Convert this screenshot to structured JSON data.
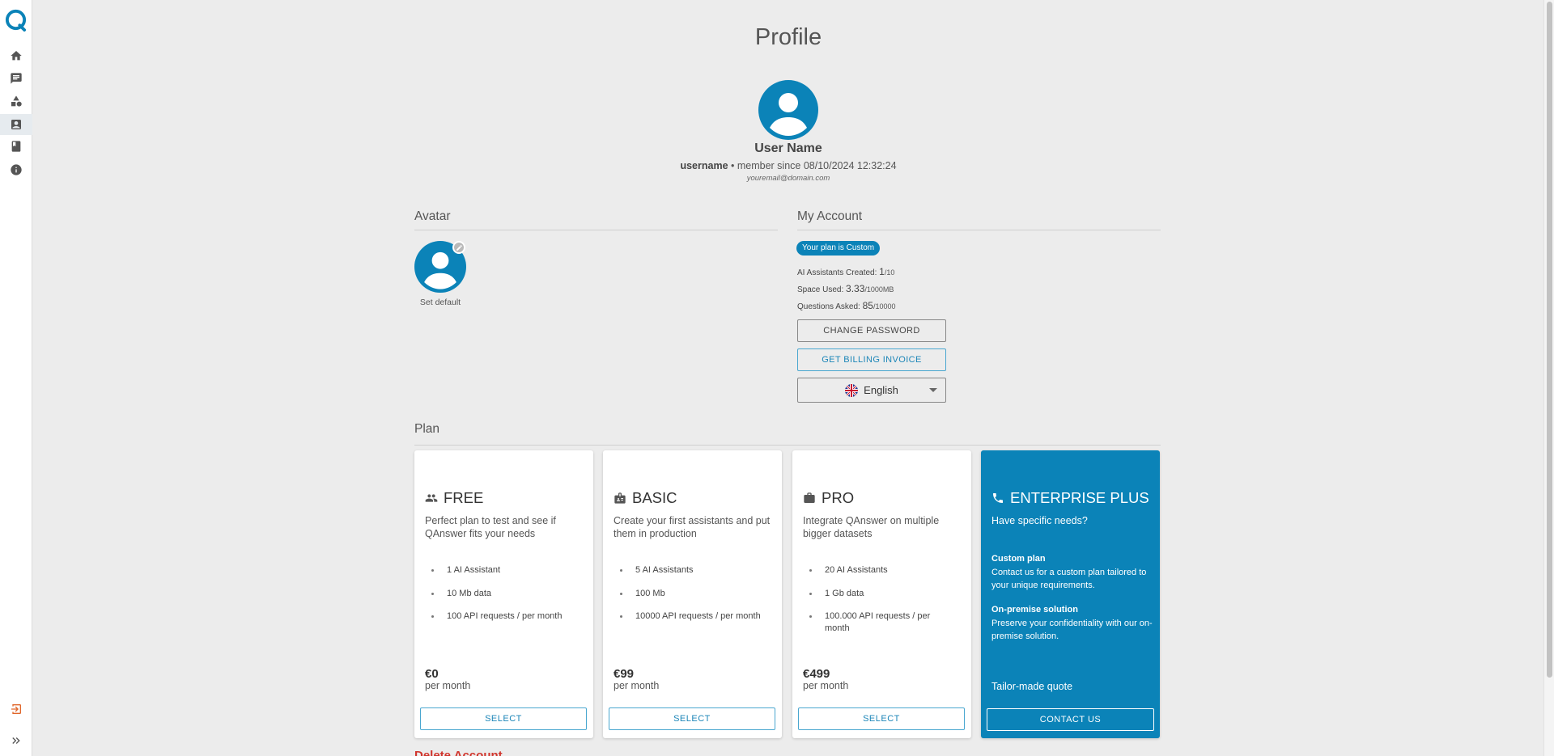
{
  "profile": {
    "title": "Profile",
    "user_name": "User Name",
    "username": "username",
    "member_since": "• member since 08/10/2024 12:32:24",
    "email": "youremail@domain.com"
  },
  "avatar_section": {
    "title": "Avatar",
    "set_default_label": "Set default"
  },
  "account": {
    "title": "My Account",
    "plan_badge": "Your plan is Custom",
    "assistants_label": "AI Assistants Created:",
    "assistants_used": "1",
    "assistants_limit": "/10",
    "space_label": "Space Used:",
    "space_used": "3.33",
    "space_limit": "/1000MB",
    "questions_label": "Questions Asked:",
    "questions_used": "85",
    "questions_limit": "/10000",
    "change_password_label": "CHANGE PASSWORD",
    "billing_invoice_label": "GET BILLING INVOICE",
    "language": "English"
  },
  "plan_section": {
    "title": "Plan",
    "cards": [
      {
        "name": "FREE",
        "icon": "people-icon",
        "description": "Perfect plan to test and see if QAnswer fits your needs",
        "features": [
          "1 AI Assistant",
          "10 Mb data",
          "100 API requests / per month"
        ],
        "price": "€0",
        "period": "per month",
        "button": "SELECT"
      },
      {
        "name": "BASIC",
        "icon": "badge-icon",
        "description": "Create your first assistants and put them in production",
        "features": [
          "5 AI Assistants",
          "100 Mb",
          "10000 API requests / per month"
        ],
        "price": "€99",
        "period": "per month",
        "button": "SELECT"
      },
      {
        "name": "PRO",
        "icon": "briefcase-icon",
        "description": "Integrate QAnswer on multiple bigger datasets",
        "features": [
          "20 AI Assistants",
          "1 Gb data",
          "100.000 API requests / per month"
        ],
        "price": "€499",
        "period": "per month",
        "button": "SELECT"
      }
    ],
    "enterprise": {
      "name": "ENTERPRISE PLUS",
      "icon": "phone-icon",
      "description": "Have specific needs?",
      "custom_title": "Custom plan",
      "custom_text": "Contact us for a custom plan tailored to your unique requirements.",
      "onprem_title": "On-premise solution",
      "onprem_text": "Preserve your confidentiality with our on-premise solution.",
      "quote": "Tailor-made quote",
      "button": "CONTACT US"
    }
  },
  "delete_account": "Delete Account",
  "sidebar": {
    "items": [
      "home-icon",
      "chat-icon",
      "shapes-icon",
      "profile-icon",
      "book-icon",
      "info-icon"
    ],
    "logout": "logout-icon",
    "expand": "expand-icon"
  },
  "colors": {
    "accent": "#0b83b8",
    "background": "#ececec",
    "danger": "#d0342c",
    "logout": "#e0662a"
  }
}
